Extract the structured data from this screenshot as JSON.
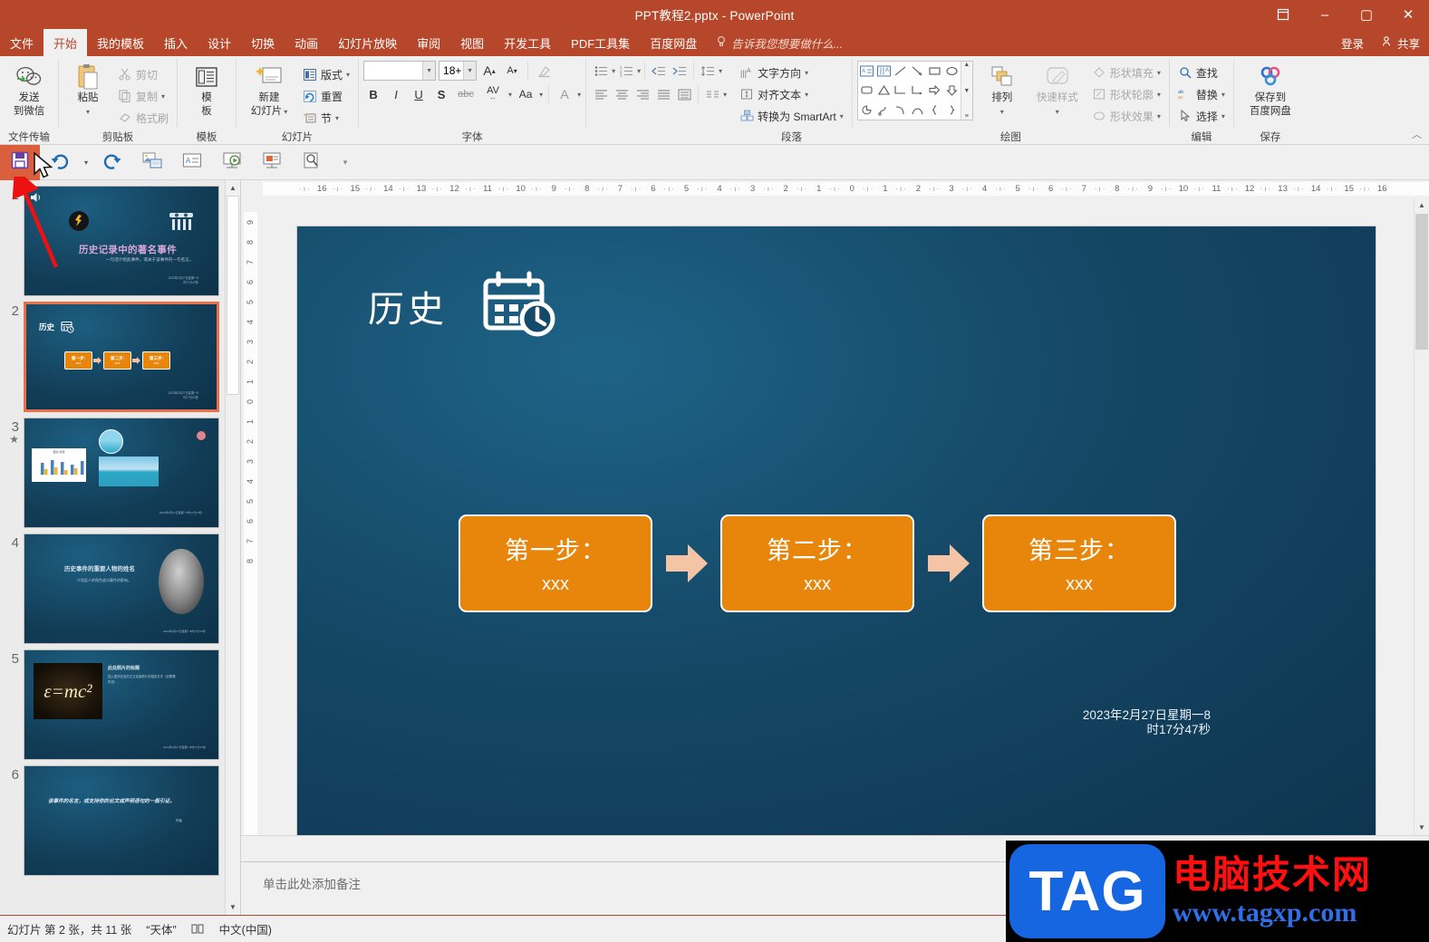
{
  "titlebar": {
    "title": "PPT教程2.pptx - PowerPoint",
    "restore_icon": "restore-window-icon",
    "minimize": "–",
    "maximize": "▢",
    "close": "✕"
  },
  "tabs": [
    {
      "label": "文件",
      "active": false
    },
    {
      "label": "开始",
      "active": true
    },
    {
      "label": "我的模板",
      "active": false
    },
    {
      "label": "插入",
      "active": false
    },
    {
      "label": "设计",
      "active": false
    },
    {
      "label": "切换",
      "active": false
    },
    {
      "label": "动画",
      "active": false
    },
    {
      "label": "幻灯片放映",
      "active": false
    },
    {
      "label": "审阅",
      "active": false
    },
    {
      "label": "视图",
      "active": false
    },
    {
      "label": "开发工具",
      "active": false
    },
    {
      "label": "PDF工具集",
      "active": false
    },
    {
      "label": "百度网盘",
      "active": false
    }
  ],
  "tellme": {
    "placeholder": "告诉我您想要做什么...",
    "icon": "lightbulb-icon"
  },
  "account": {
    "signin": "登录",
    "share": "共享",
    "share_icon": "person-share-icon"
  },
  "ribbon": {
    "groups": [
      {
        "label": "文件传输",
        "buttons": [
          {
            "label": "发送\n到微信",
            "l1": "发送",
            "l2": "到微信",
            "icon": "wechat-icon"
          }
        ]
      },
      {
        "label": "剪贴板",
        "paste": {
          "l1": "粘贴",
          "icon": "paste-icon"
        },
        "items": [
          {
            "label": "剪切",
            "icon": "scissors-icon",
            "dim": true
          },
          {
            "label": "复制",
            "icon": "copy-icon",
            "dim": true
          },
          {
            "label": "格式刷",
            "icon": "format-painter-icon",
            "dim": true
          }
        ]
      },
      {
        "label": "模板",
        "buttons": [
          {
            "l1": "模",
            "l2": "板",
            "icon": "template-icon"
          }
        ]
      },
      {
        "label": "幻灯片",
        "newslide": {
          "l1": "新建",
          "l2": "幻灯片",
          "icon": "new-slide-icon"
        },
        "items": [
          {
            "label": "版式",
            "icon": "layout-icon"
          },
          {
            "label": "重置",
            "icon": "reset-icon"
          },
          {
            "label": "节",
            "icon": "section-icon"
          }
        ]
      },
      {
        "label": "字体",
        "font_name": "",
        "font_name_placeholder": "",
        "font_size": "18+",
        "grow": "A",
        "shrink": "A",
        "clear_format_icon": "clear-format-icon",
        "bold": "B",
        "italic": "I",
        "underline": "U",
        "shadow": "S",
        "strike": "abc",
        "spacing": "AV",
        "case": "Aa",
        "color": "A"
      },
      {
        "label": "段落",
        "items": [
          {
            "label": "文字方向",
            "icon": "text-direction-icon"
          },
          {
            "label": "对齐文本",
            "icon": "align-text-icon"
          },
          {
            "label": "转换为 SmartArt",
            "icon": "smartart-icon"
          }
        ]
      },
      {
        "label": "绘图",
        "arrange": {
          "label": "排列",
          "icon": "arrange-icon"
        },
        "quickstyle": {
          "label": "快速样式",
          "icon": "quick-style-icon"
        },
        "items": [
          {
            "label": "形状填充",
            "icon": "shape-fill-icon",
            "dim": true
          },
          {
            "label": "形状轮廓",
            "icon": "shape-outline-icon",
            "dim": true
          },
          {
            "label": "形状效果",
            "icon": "shape-effects-icon",
            "dim": true
          }
        ]
      },
      {
        "label": "编辑",
        "items": [
          {
            "label": "查找",
            "icon": "search-icon"
          },
          {
            "label": "替换",
            "icon": "replace-icon"
          },
          {
            "label": "选择",
            "icon": "select-icon"
          }
        ]
      },
      {
        "label": "保存",
        "buttons": [
          {
            "l1": "保存到",
            "l2": "百度网盘",
            "icon": "baidu-netdisk-icon"
          }
        ]
      }
    ],
    "collapse_icon": "chevron-up-icon"
  },
  "qat": {
    "buttons": [
      {
        "name": "save-button",
        "icon": "save-icon",
        "selected": true
      },
      {
        "name": "undo-button",
        "icon": "undo-icon",
        "selected": false
      },
      {
        "name": "redo-button",
        "icon": "redo-icon",
        "selected": false
      },
      {
        "name": "insert-picture-button",
        "icon": "picture-insert-icon",
        "selected": false
      },
      {
        "name": "text-box-button",
        "icon": "text-box-icon",
        "selected": false
      },
      {
        "name": "start-slideshow-button",
        "icon": "slideshow-play-icon",
        "selected": false
      },
      {
        "name": "present-button",
        "icon": "present-screen-icon",
        "selected": false
      },
      {
        "name": "print-preview-button",
        "icon": "print-preview-icon",
        "selected": false
      },
      {
        "name": "customize-qat-button",
        "icon": "chevron-down-icon",
        "selected": false
      }
    ]
  },
  "thumbnails": [
    {
      "num": "1",
      "star": "",
      "active": false,
      "kind": "title"
    },
    {
      "num": "2",
      "star": "",
      "active": true,
      "kind": "process"
    },
    {
      "num": "3",
      "star": "★",
      "active": false,
      "kind": "chart"
    },
    {
      "num": "4",
      "star": "",
      "active": false,
      "kind": "portrait"
    },
    {
      "num": "5",
      "star": "",
      "active": false,
      "kind": "photo"
    },
    {
      "num": "6",
      "star": "",
      "active": false,
      "kind": "quote"
    }
  ],
  "thumb_content": {
    "s1_title": "历史记录中的著名事件",
    "s1_sub": "一句话介绍此事件，或关于该事件的一句名言。",
    "s2_title": "历史",
    "s4_title": "历史事件的重要人物的姓名",
    "s4_sub": "介绍此人的角色或对事件的影响。",
    "s5_title": "此处照片的标题",
    "s5_body": "插入更多信息的正文或者照片的描述文字（如需要的话）。",
    "s6_quote": "该事件的名言，或支持你的论文或声明语句的一般引证。"
  },
  "ruler": {
    "h_left": [
      "16",
      "15",
      "14",
      "13",
      "12",
      "11",
      "10",
      "9",
      "8",
      "7",
      "6",
      "5",
      "4",
      "3",
      "2",
      "1"
    ],
    "h_center": "0",
    "h_right": [
      "1",
      "2",
      "3",
      "4",
      "5",
      "6",
      "7",
      "8",
      "9",
      "10",
      "11",
      "12",
      "13",
      "14",
      "15",
      "16"
    ],
    "v_top": [
      "9",
      "8",
      "7",
      "6",
      "5",
      "4",
      "3",
      "2",
      "1"
    ],
    "v_center": "0",
    "v_bottom": [
      "1",
      "2",
      "3",
      "4",
      "5",
      "6",
      "7",
      "8"
    ]
  },
  "slide": {
    "title": "历史",
    "title_icon": "calendar-clock-icon",
    "boxes": [
      {
        "step": "第一步：",
        "value": "xxx"
      },
      {
        "step": "第二步：",
        "value": "xxx"
      },
      {
        "step": "第三步：",
        "value": "xxx"
      }
    ],
    "arrow_icon": "right-arrow-icon",
    "date_line1": "2023年2月27日星期一8",
    "date_line2": "时17分47秒",
    "box_color": "#e8860c",
    "arrow_color": "#f5c4a5",
    "bg_color": "#15486 6"
  },
  "notes": {
    "placeholder": "单击此处添加备注"
  },
  "status": {
    "slide_info": "幻灯片 第 2 张，共 11 张",
    "theme": "“天体”",
    "spellcheck_icon": "spellcheck-icon",
    "language": "中文(中国)"
  },
  "watermark": {
    "logo": "TAG",
    "cn": "电脑技术网",
    "url": "www.tagxp.com"
  },
  "annotation": {
    "arrow_icon": "red-arrow-annotation",
    "cursor_icon": "mouse-cursor-icon"
  }
}
